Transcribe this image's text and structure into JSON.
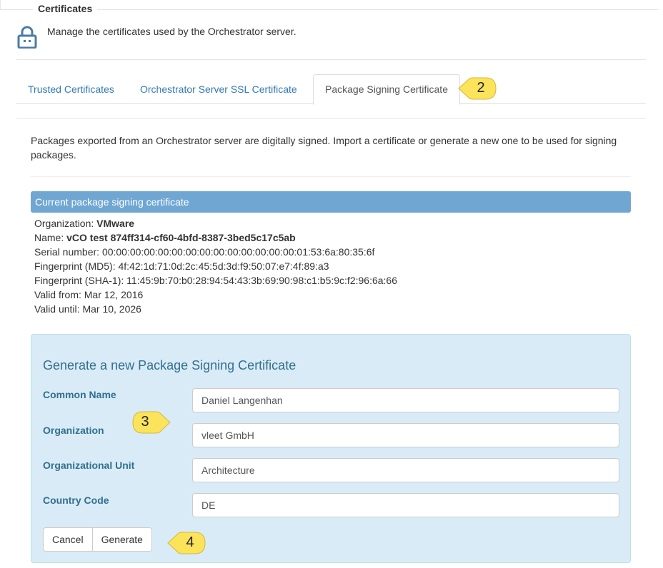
{
  "header": {
    "legend": "Certificates",
    "description": "Manage the certificates used by the Orchestrator server."
  },
  "tabs": [
    {
      "label": "Trusted Certificates",
      "active": false
    },
    {
      "label": "Orchestrator Server SSL Certificate",
      "active": false
    },
    {
      "label": "Package Signing Certificate",
      "active": true
    }
  ],
  "intro": "Packages exported from an Orchestrator server are digitally signed. Import a certificate or generate a new one to be used for signing packages.",
  "current_cert": {
    "header": "Current package signing certificate",
    "organization_label": "Organization:",
    "organization": "VMware",
    "name_label": "Name:",
    "name": "vCO test 874ff314-cf60-4bfd-8387-3bed5c17c5ab",
    "serial_label": "Serial number:",
    "serial": "00:00:00:00:00:00:00:00:00:00:00:00:00:00:01:53:6a:80:35:6f",
    "md5_label": "Fingerprint (MD5):",
    "md5": "4f:42:1d:71:0d:2c:45:5d:3d:f9:50:07:e7:4f:89:a3",
    "sha1_label": "Fingerprint (SHA-1):",
    "sha1": "11:45:9b:70:b0:28:94:54:43:3b:69:90:98:c1:b5:9c:f2:96:6a:66",
    "valid_from_label": "Valid from:",
    "valid_from": "Mar 12, 2016",
    "valid_until_label": "Valid until:",
    "valid_until": "Mar 10, 2026"
  },
  "generate": {
    "title": "Generate a new Package Signing Certificate",
    "fields": [
      {
        "label": "Common Name",
        "value": "Daniel Langenhan"
      },
      {
        "label": "Organization",
        "value": "vleet GmbH"
      },
      {
        "label": "Organizational Unit",
        "value": "Architecture"
      },
      {
        "label": "Country Code",
        "value": "DE"
      }
    ],
    "cancel_label": "Cancel",
    "generate_label": "Generate"
  },
  "callouts": {
    "c2": "2",
    "c3": "3",
    "c4": "4"
  },
  "colors": {
    "link": "#337ab7",
    "panel_bg": "#d9ebf6",
    "panel_text": "#31708f",
    "cert_header_bg": "#70a7d2",
    "callout": "#fbe35c"
  }
}
